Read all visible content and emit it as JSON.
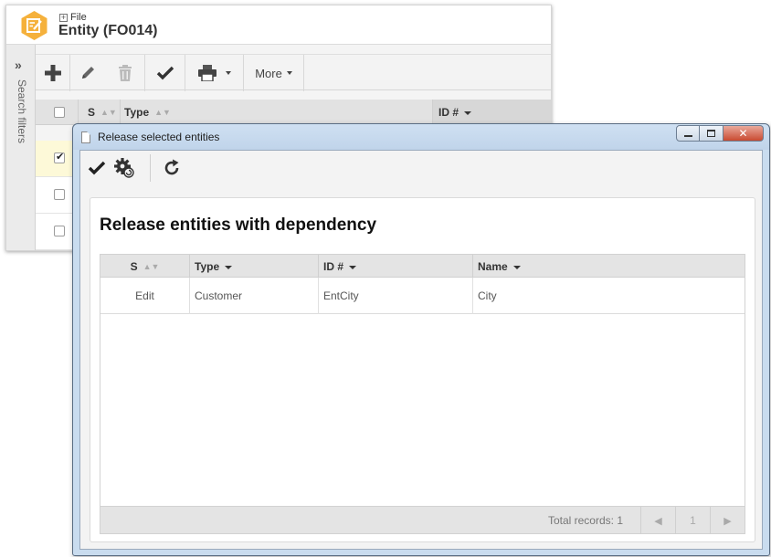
{
  "background_window": {
    "breadcrumb": "File",
    "title": "Entity (FO014)",
    "side_panel_label": "Search filters",
    "toolbar": {
      "more_label": "More"
    },
    "table": {
      "columns": [
        "S",
        "Type",
        "ID #"
      ],
      "rows": [
        {
          "checked": true
        },
        {
          "checked": false
        },
        {
          "checked": false
        }
      ]
    }
  },
  "modal": {
    "title": "Release selected entities",
    "heading": "Release entities with dependency",
    "columns": [
      "S",
      "Type",
      "ID #",
      "Name"
    ],
    "rows": [
      {
        "s": "Edit",
        "type": "Customer",
        "id": "EntCity",
        "name": "City"
      }
    ],
    "footer": {
      "total_records": "Total records: 1",
      "page": "1"
    }
  },
  "colors": {
    "app_icon": "#f5b13c",
    "modal_frame": "#c9dcef",
    "close_button": "#c94a31",
    "selected_row": "#fdf9d8"
  }
}
